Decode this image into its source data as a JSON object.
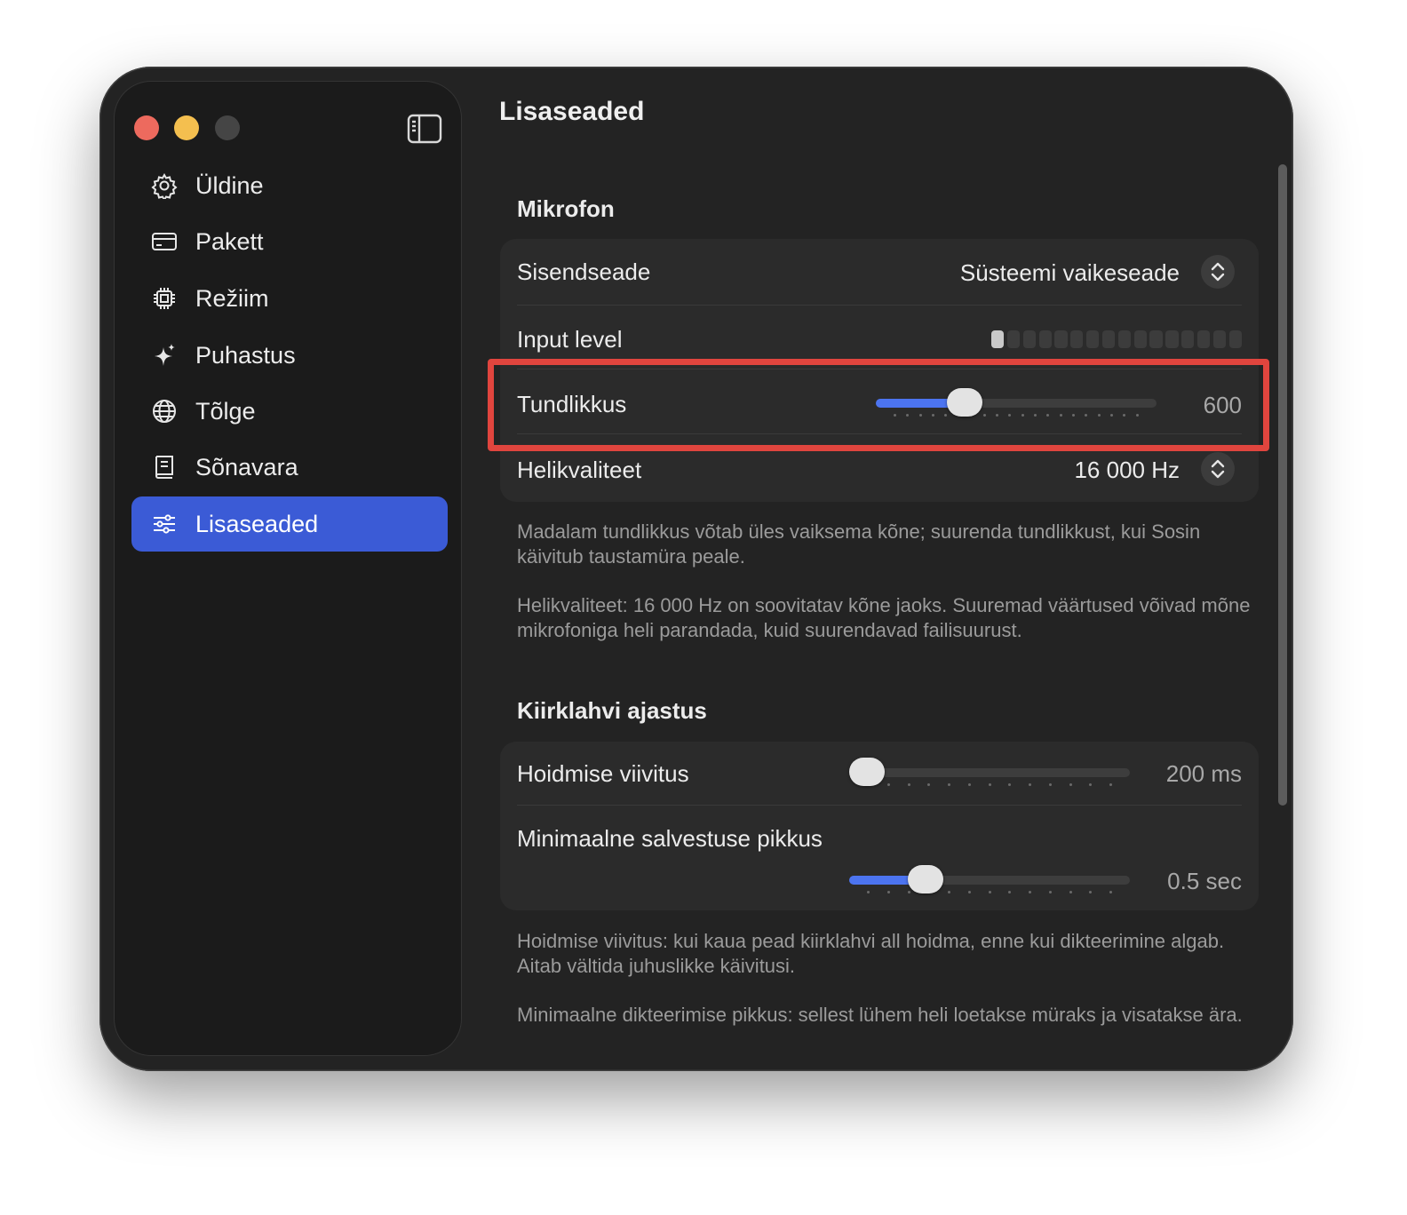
{
  "sidebar": {
    "items": [
      {
        "label": "Üldine",
        "icon": "gear-icon"
      },
      {
        "label": "Pakett",
        "icon": "credit-card-icon"
      },
      {
        "label": "Režiim",
        "icon": "cpu-chip-icon"
      },
      {
        "label": "Puhastus",
        "icon": "sparkle-icon"
      },
      {
        "label": "Tõlge",
        "icon": "globe-icon"
      },
      {
        "label": "Sõnavara",
        "icon": "book-icon"
      },
      {
        "label": "Lisaseaded",
        "icon": "sliders-icon",
        "active": true
      }
    ]
  },
  "main": {
    "title": "Lisaseaded",
    "microphone": {
      "section_title": "Mikrofon",
      "input_device": {
        "label": "Sisendseade",
        "value": "Süsteemi vaikeseade"
      },
      "input_level": {
        "label": "Input level",
        "segments": 16,
        "active_segments": 1
      },
      "sensitivity": {
        "label": "Tundlikkus",
        "value_text": "600",
        "fraction": 0.29
      },
      "sound_quality": {
        "label": "Helikvaliteet",
        "value": "16 000 Hz"
      },
      "help_1": "Madalam tundlikkus võtab üles vaiksema kõne; suurenda tundlikkust, kui Sosin käivitub taustamüra peale.",
      "help_2": "Helikvaliteet: 16 000 Hz on soovitatav kõne jaoks. Suuremad väärtused võivad mõne mikrofoniga heli parandada, kuid suurendavad failisuurust."
    },
    "hotkey": {
      "section_title": "Kiirklahvi ajastus",
      "hold_delay": {
        "label": "Hoidmise viivitus",
        "value_text": "200 ms",
        "fraction": 0.0
      },
      "min_length": {
        "label": "Minimaalne salvestuse pikkus",
        "value_text": "0.5 sec",
        "fraction": 0.24
      },
      "help_1": "Hoidmise viivitus: kui kaua pead kiirklahvi all hoidma, enne kui dikteerimine algab. Aitab vältida juhuslikke käivitusi.",
      "help_2": "Minimaalne dikteerimise pikkus: sellest lühem heli loetakse müraks ja visatakse ära."
    }
  },
  "colors": {
    "accent": "#3b5bd6",
    "slider_fill": "#4c74f0",
    "highlight": "#e0453e"
  }
}
